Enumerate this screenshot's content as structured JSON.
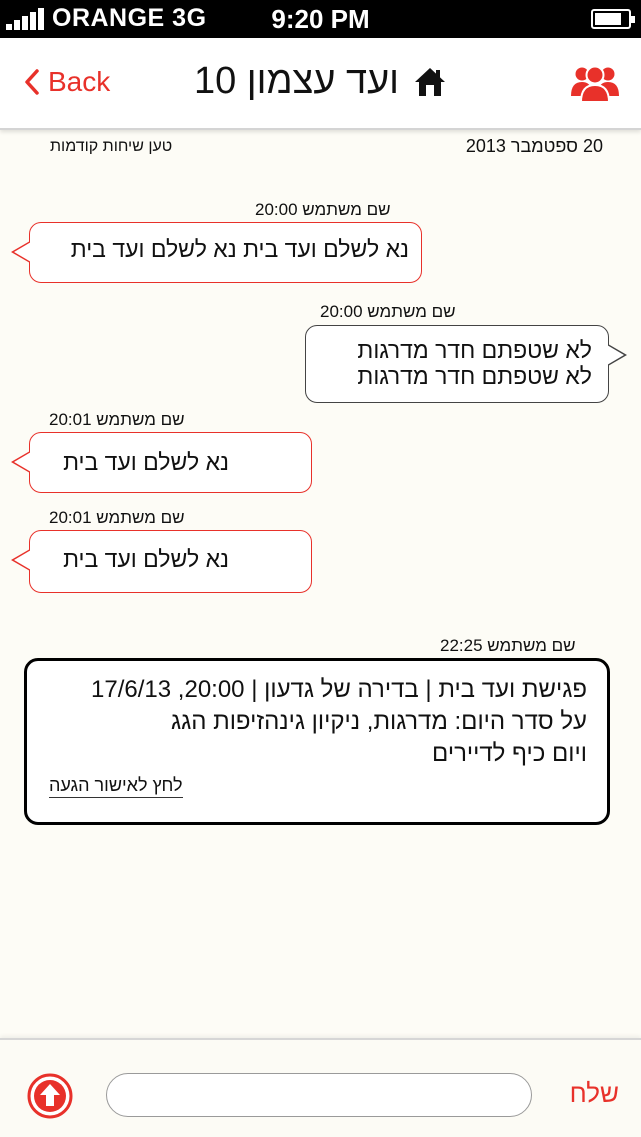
{
  "status": {
    "carrier": "ORANGE  3G",
    "time": "9:20 PM",
    "battery_level": 0.8
  },
  "nav": {
    "back_label": "Back",
    "title": "ועד עצמון 10",
    "title_icon": "house-icon",
    "group_icon": "group-icon",
    "accent_color": "#e8312a"
  },
  "conversation": {
    "date": "20 ספטמבר 2013",
    "load_earlier": "טען שיחות קודמות"
  },
  "messages": [
    {
      "side": "left",
      "sender": "שם משתמש",
      "time": "20:00",
      "lines": [
        "נא לשלם ועד בית נא לשלם ועד בית"
      ]
    },
    {
      "side": "right",
      "sender": "שם משתמש",
      "time": "20:00",
      "lines": [
        "לא שטפתם חדר מדרגות",
        "לא שטפתם חדר מדרגות"
      ]
    },
    {
      "side": "left",
      "sender": "שם משתמש",
      "time": "20:01",
      "lines": [
        "נא לשלם ועד בית"
      ]
    },
    {
      "side": "left",
      "sender": "שם משתמש",
      "time": "20:01",
      "lines": [
        "נא לשלם ועד בית"
      ]
    }
  ],
  "event": {
    "sender": "שם משתמש",
    "time": "22:25",
    "line1": "פגישת ועד בית | בדירה של גדעון | 20:00, 17/6/13",
    "line2": "על סדר היום: מדרגות, ניקיון גינהזיפות הגג",
    "line3": "ויום כיף לדיירים",
    "confirm_label": "לחץ לאישור הגעה"
  },
  "composer": {
    "placeholder": "",
    "value": "",
    "send_label": "שלח",
    "upload_icon": "upload-arrow-icon"
  }
}
